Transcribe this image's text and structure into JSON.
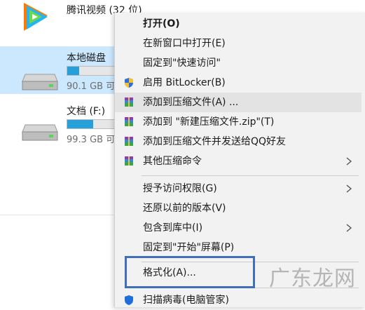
{
  "explorer": {
    "app_item": {
      "name": "腾讯视频 (32 位)"
    },
    "drives": [
      {
        "name": "本地磁盘",
        "free": "90.1 GB 可",
        "used_fraction": 0.25,
        "selected": true
      },
      {
        "name": "文档 (F:)",
        "free": "99.3 GB 可",
        "used_fraction": 0.55,
        "selected": false
      }
    ]
  },
  "context_menu": {
    "open": "打开(O)",
    "open_new_window": "在新窗口中打开(E)",
    "pin_quick_access": "固定到\"快速访问\"",
    "bitlocker": "启用 BitLocker(B)",
    "add_to_archive": "添加到压缩文件(A) ...",
    "add_to_zip": "添加到 \"新建压缩文件.zip\"(T)",
    "add_and_send_qq": "添加到压缩文件并发送给QQ好友",
    "other_compress": "其他压缩命令",
    "grant_access": "授予访问权限(G)",
    "restore_versions": "还原以前的版本(V)",
    "include_library": "包含到库中(I)",
    "pin_start": "固定到\"开始\"屏幕(P)",
    "format": "格式化(A)...",
    "scan_virus": "扫描病毒(电脑管家)"
  },
  "watermark": "广东龙网",
  "colors": {
    "accent": "#26a0da",
    "selection": "#cce8ff",
    "highlight_box": "#3e6fb8"
  },
  "icons": {
    "app": "tencent-video-icon",
    "drive": "hard-drive-icon",
    "shield": "uac-shield-icon",
    "archive": "winrar-archive-icon",
    "submenu": "chevron-right-icon"
  }
}
